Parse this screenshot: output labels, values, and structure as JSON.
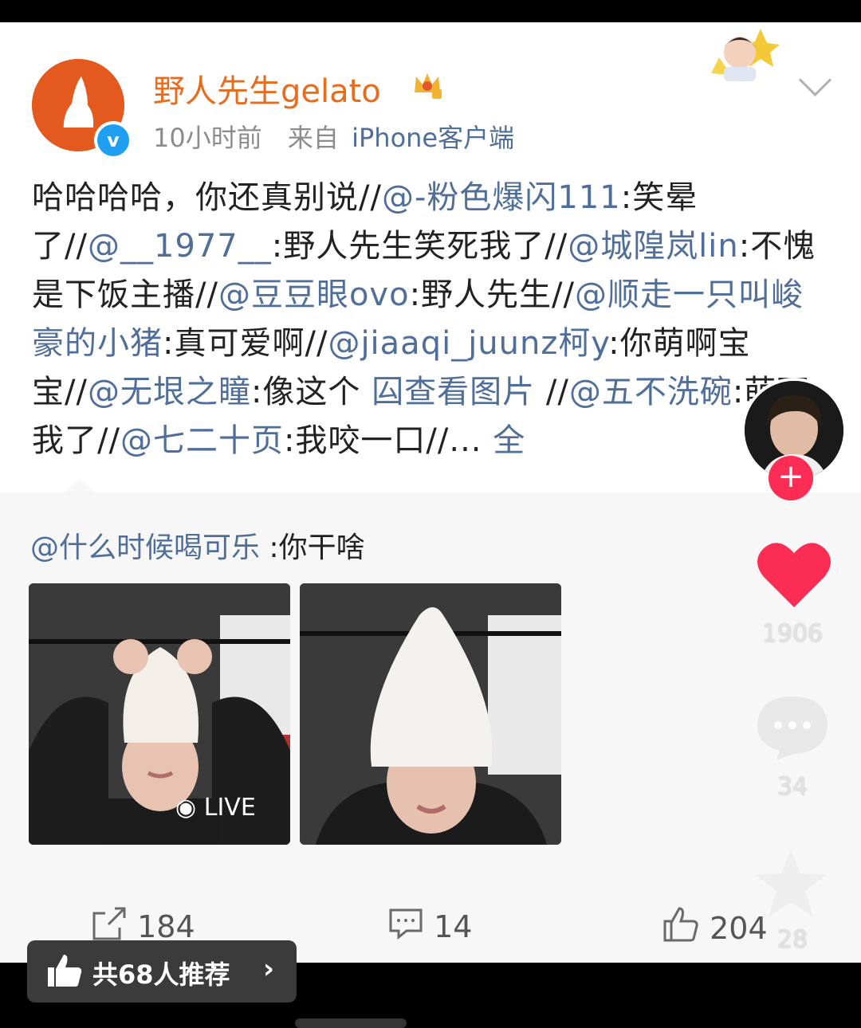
{
  "post": {
    "username": "野人先生gelato",
    "time": "10小时前",
    "source_prefix": "来自",
    "source_client": "iPhone客户端",
    "verified_mark": "v",
    "body": [
      {
        "t": "哈哈哈哈，你还真别说//",
        "m": false
      },
      {
        "t": "@-粉色爆闪111",
        "m": true
      },
      {
        "t": ":笑晕了//",
        "m": false
      },
      {
        "t": "@__1977__",
        "m": true
      },
      {
        "t": ":野人先生笑死我了//",
        "m": false
      },
      {
        "t": "@城隍岚lin",
        "m": true
      },
      {
        "t": ":不愧是下饭主播//",
        "m": false
      },
      {
        "t": "@豆豆眼ovo",
        "m": true
      },
      {
        "t": ":野人先生//",
        "m": false
      },
      {
        "t": "@顺走一只叫峻豪的小猪",
        "m": true
      },
      {
        "t": ":真可爱啊//",
        "m": false
      },
      {
        "t": "@jiaaqi_juunz柯y",
        "m": true
      },
      {
        "t": ":你萌啊宝宝//",
        "m": false
      },
      {
        "t": "@无垠之瞳",
        "m": true
      },
      {
        "t": ":像这个 ",
        "m": false
      },
      {
        "t": "囜查看图片",
        "m": true
      },
      {
        "t": "  //",
        "m": false
      },
      {
        "t": "@五",
        "m": true
      },
      {
        "t": "不洗碗",
        "m": true
      },
      {
        "t": ":萌死我了//",
        "m": false
      },
      {
        "t": "@七二十页",
        "m": true
      },
      {
        "t": ":我咬一口//... ",
        "m": false
      },
      {
        "t": "全",
        "m": true
      }
    ]
  },
  "quoted": {
    "mention": "@什么时候喝可乐",
    "text": " :你干啥",
    "live_label": "LIVE"
  },
  "actions": {
    "repost_count": "184",
    "comment_count": "14",
    "like_count": "204"
  },
  "side": {
    "heart_count": "1906",
    "comment_count": "34",
    "star_count": "28",
    "follow_symbol": "+"
  },
  "recommend": {
    "label": "共68人推荐"
  },
  "colors": {
    "username": "#e86c1d",
    "mention": "#4f6e99",
    "verified": "#1f9ff2",
    "heart": "#fc2d55"
  }
}
